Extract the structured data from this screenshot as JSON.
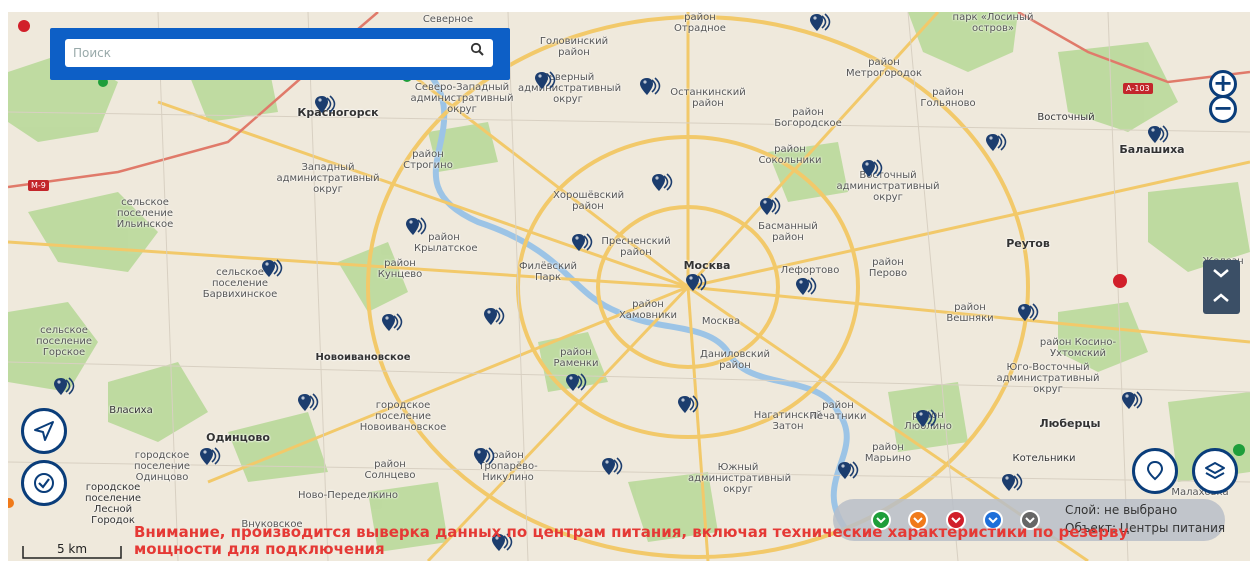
{
  "search": {
    "placeholder": "Поиск"
  },
  "map_labels": {
    "moskva": "Москва",
    "reutov": "Реутов",
    "balashikha": "Балашиха",
    "krasnogorsk": "Красногорск",
    "odintsovo": "Одинцово",
    "lyubertsy": "Люберцы",
    "novoivanovskoe": "Новоивановское",
    "vlasikha": "Власиха",
    "khoroshevsky": "Хорошёвский район",
    "presnensky": "Пресненский район",
    "khamovniki": "район Хамовники",
    "moskva_river": "Москва",
    "fili": "Филёвский Парк",
    "danilovsky": "Даниловский район",
    "lefortovo": "Лефортово",
    "basmanny": "Басманный район",
    "sokolniki": "район Сокольники",
    "ostankinsky": "Останкинский район",
    "golovinsky": "Головинский район",
    "severny": "Северный административный округ",
    "szao": "Северо-Западный административный округ",
    "zao": "Западный административный округ",
    "svao": "Восточный административный округ",
    "yuvao": "Юго-Восточный административный округ",
    "yuzhny": "Южный административный округ",
    "strogino": "район Строгино",
    "krylatskoe": "район Крылатское",
    "kuntsevo": "район Кунцево",
    "ramenki": "район Раменки",
    "solntsevo": "район Солнцево",
    "troparevo": "район Тропарёво-Никулино",
    "nagatinsky": "Нагатинский Затон",
    "pechatniki": "район Печатники",
    "lyublino": "район Люблино",
    "maryino": "район Марьино",
    "kotelniki": "Котельники",
    "veshnyaki": "район Вешняки",
    "perovo": "район Перово",
    "kosino": "район Косино-Ухтомский",
    "goljanovo": "район Гольяново",
    "bogorodskoe": "район Богородское",
    "metrogorodok": "район Метрогородок",
    "otradnoe": "район Отрадное",
    "barvikha": "сельское поселение Барвихинское",
    "ilyinskoe": "сельское поселение Ильинское",
    "gorskoe": "сельское поселение Горское",
    "novoivanovskoe_pos": "городское поселение Новоивановское",
    "odintsovo_pos": "городское поселение Одинцово",
    "lesnoy": "городское поселение Лесной Городок",
    "losiny": "парк «Лосиный остров»",
    "zheleznodorozhny": "Железн",
    "severnoe": "Северное",
    "novo_peredelkino": "Ново-Переделкино",
    "vostochny": "Восточный",
    "yuzhnoe_butovo": "Малаховка",
    "vnukovo": "Внуковское",
    "road_m9": "М-9",
    "road_a103": "А-103"
  },
  "legend": {
    "layer_text": "Слой: не выбрано",
    "object_text": "Объект: Центры питания",
    "colors": [
      "#1e9e3a",
      "#f07a1a",
      "#d11f2a",
      "#1e6fd9",
      "#666666"
    ]
  },
  "warning": "Внимание, производится выверка данных по центрам питания, включая технические характеристики по резерву мощности для подключения",
  "scale": {
    "label": "5 km"
  },
  "colors": {
    "accent": "#0a3d7a",
    "search_bg": "#0d5fc6",
    "marker": "#1c3d6e",
    "warning": "#e53935"
  }
}
